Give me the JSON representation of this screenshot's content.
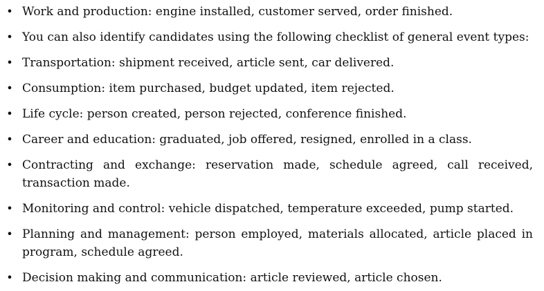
{
  "document": {
    "bullet_glyph": "•",
    "items": [
      "Work and production: engine installed, customer served, order finished.",
      "You can also identify candidates using the following checklist of general event types:",
      "Transportation: shipment received, article sent, car delivered.",
      "Consumption: item purchased, budget updated, item rejected.",
      "Life cycle: person created, person rejected, conference finished.",
      "Career and education: graduated, job offered, resigned, enrolled in a class.",
      "Contracting and exchange: reservation made, schedule agreed, call received, transaction made.",
      "Monitoring and control: vehicle dispatched, temperature exceeded, pump started.",
      "Planning and management: person employed, materials allocated, article placed in program, schedule agreed.",
      "Decision making and communication: article reviewed, article chosen."
    ]
  }
}
